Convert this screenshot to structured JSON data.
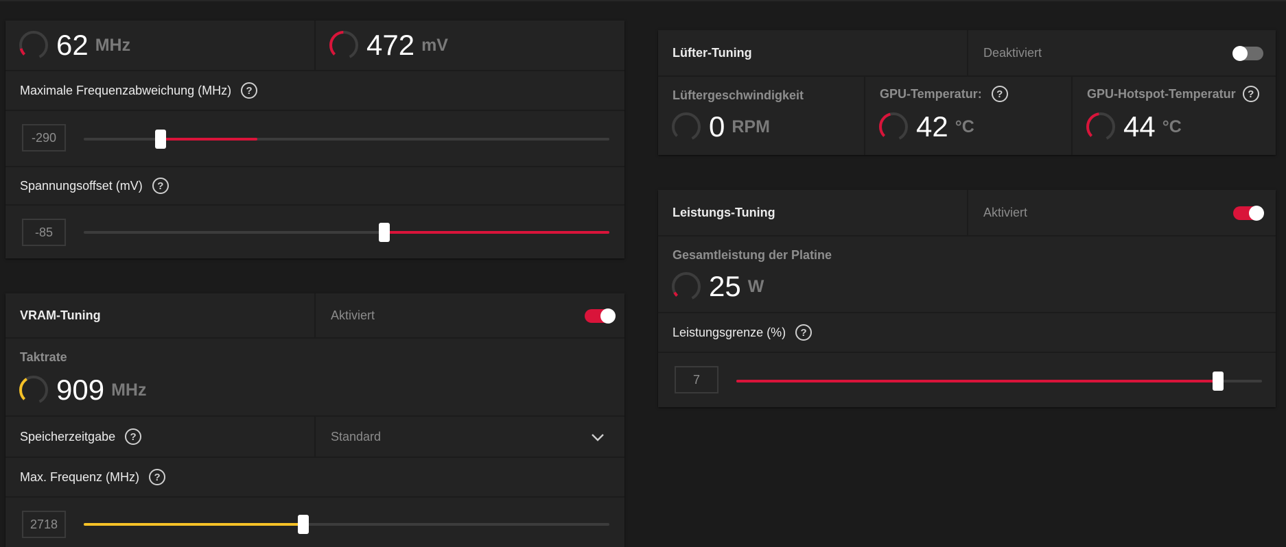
{
  "colors": {
    "accent_red": "#d9143a",
    "accent_yellow": "#f5c127",
    "gauge_track": "#3d3d3d"
  },
  "gpu": {
    "clock": {
      "value": "62",
      "unit": "MHz"
    },
    "voltage": {
      "value": "472",
      "unit": "mV"
    },
    "max_freq_offset": {
      "label": "Maximale Frequenzabweichung (MHz)",
      "value": "-290",
      "level_percent": 33
    },
    "voltage_offset": {
      "label": "Spannungsoffset (mV)",
      "value": "-85",
      "level_percent": 100
    }
  },
  "vram": {
    "title": "VRAM-Tuning",
    "status": "Aktiviert",
    "enabled": true,
    "clock_title": "Taktrate",
    "clock_value": "909",
    "clock_unit": "MHz",
    "timing_label": "Speicherzeitgabe",
    "timing_value": "Standard",
    "max_freq_label": "Max. Frequenz (MHz)",
    "max_freq_value": "2718",
    "max_freq_level_percent": 42
  },
  "fan": {
    "title": "Lüfter-Tuning",
    "status": "Deaktiviert",
    "enabled": false,
    "speed_title": "Lüftergeschwindigkeit",
    "speed_value": "0",
    "speed_unit": "RPM",
    "temp_title": "GPU-Temperatur:",
    "temp_value": "42",
    "temp_unit": "°C",
    "hotspot_title": "GPU-Hotspot-Temperatur",
    "hotspot_value": "44",
    "hotspot_unit": "°C"
  },
  "power": {
    "title": "Leistungs-Tuning",
    "status": "Aktiviert",
    "enabled": true,
    "board_title": "Gesamtleistung der Platine",
    "board_value": "25",
    "board_unit": "W",
    "limit_label": "Leistungsgrenze (%)",
    "limit_value": "7",
    "limit_level_percent": 92
  },
  "icons": {
    "help": "?"
  }
}
